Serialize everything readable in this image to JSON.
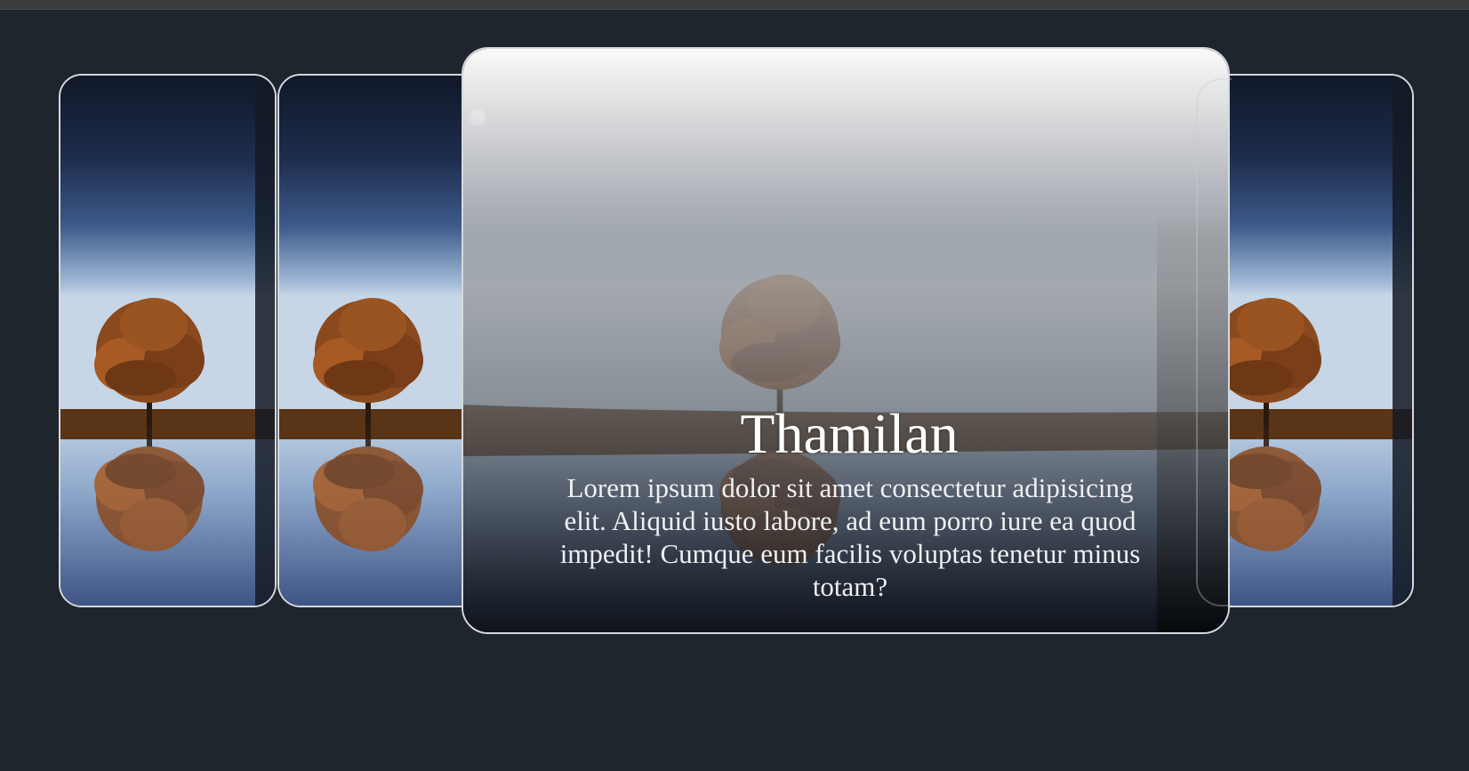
{
  "carousel": {
    "active": {
      "title": "Thamilan",
      "description": "Lorem ipsum dolor sit amet consectetur adipisicing elit. Aliquid iusto labore, ad eum porro iure ea quod impedit! Cumque eum facilis voluptas tenetur minus totam?"
    },
    "slide_image": "lone-tree-at-night-reflected-in-lake",
    "slide_count_visible": 4
  },
  "colors": {
    "background": "#1f252d",
    "card_border": "#d6d9dc",
    "text": "#ffffff"
  }
}
